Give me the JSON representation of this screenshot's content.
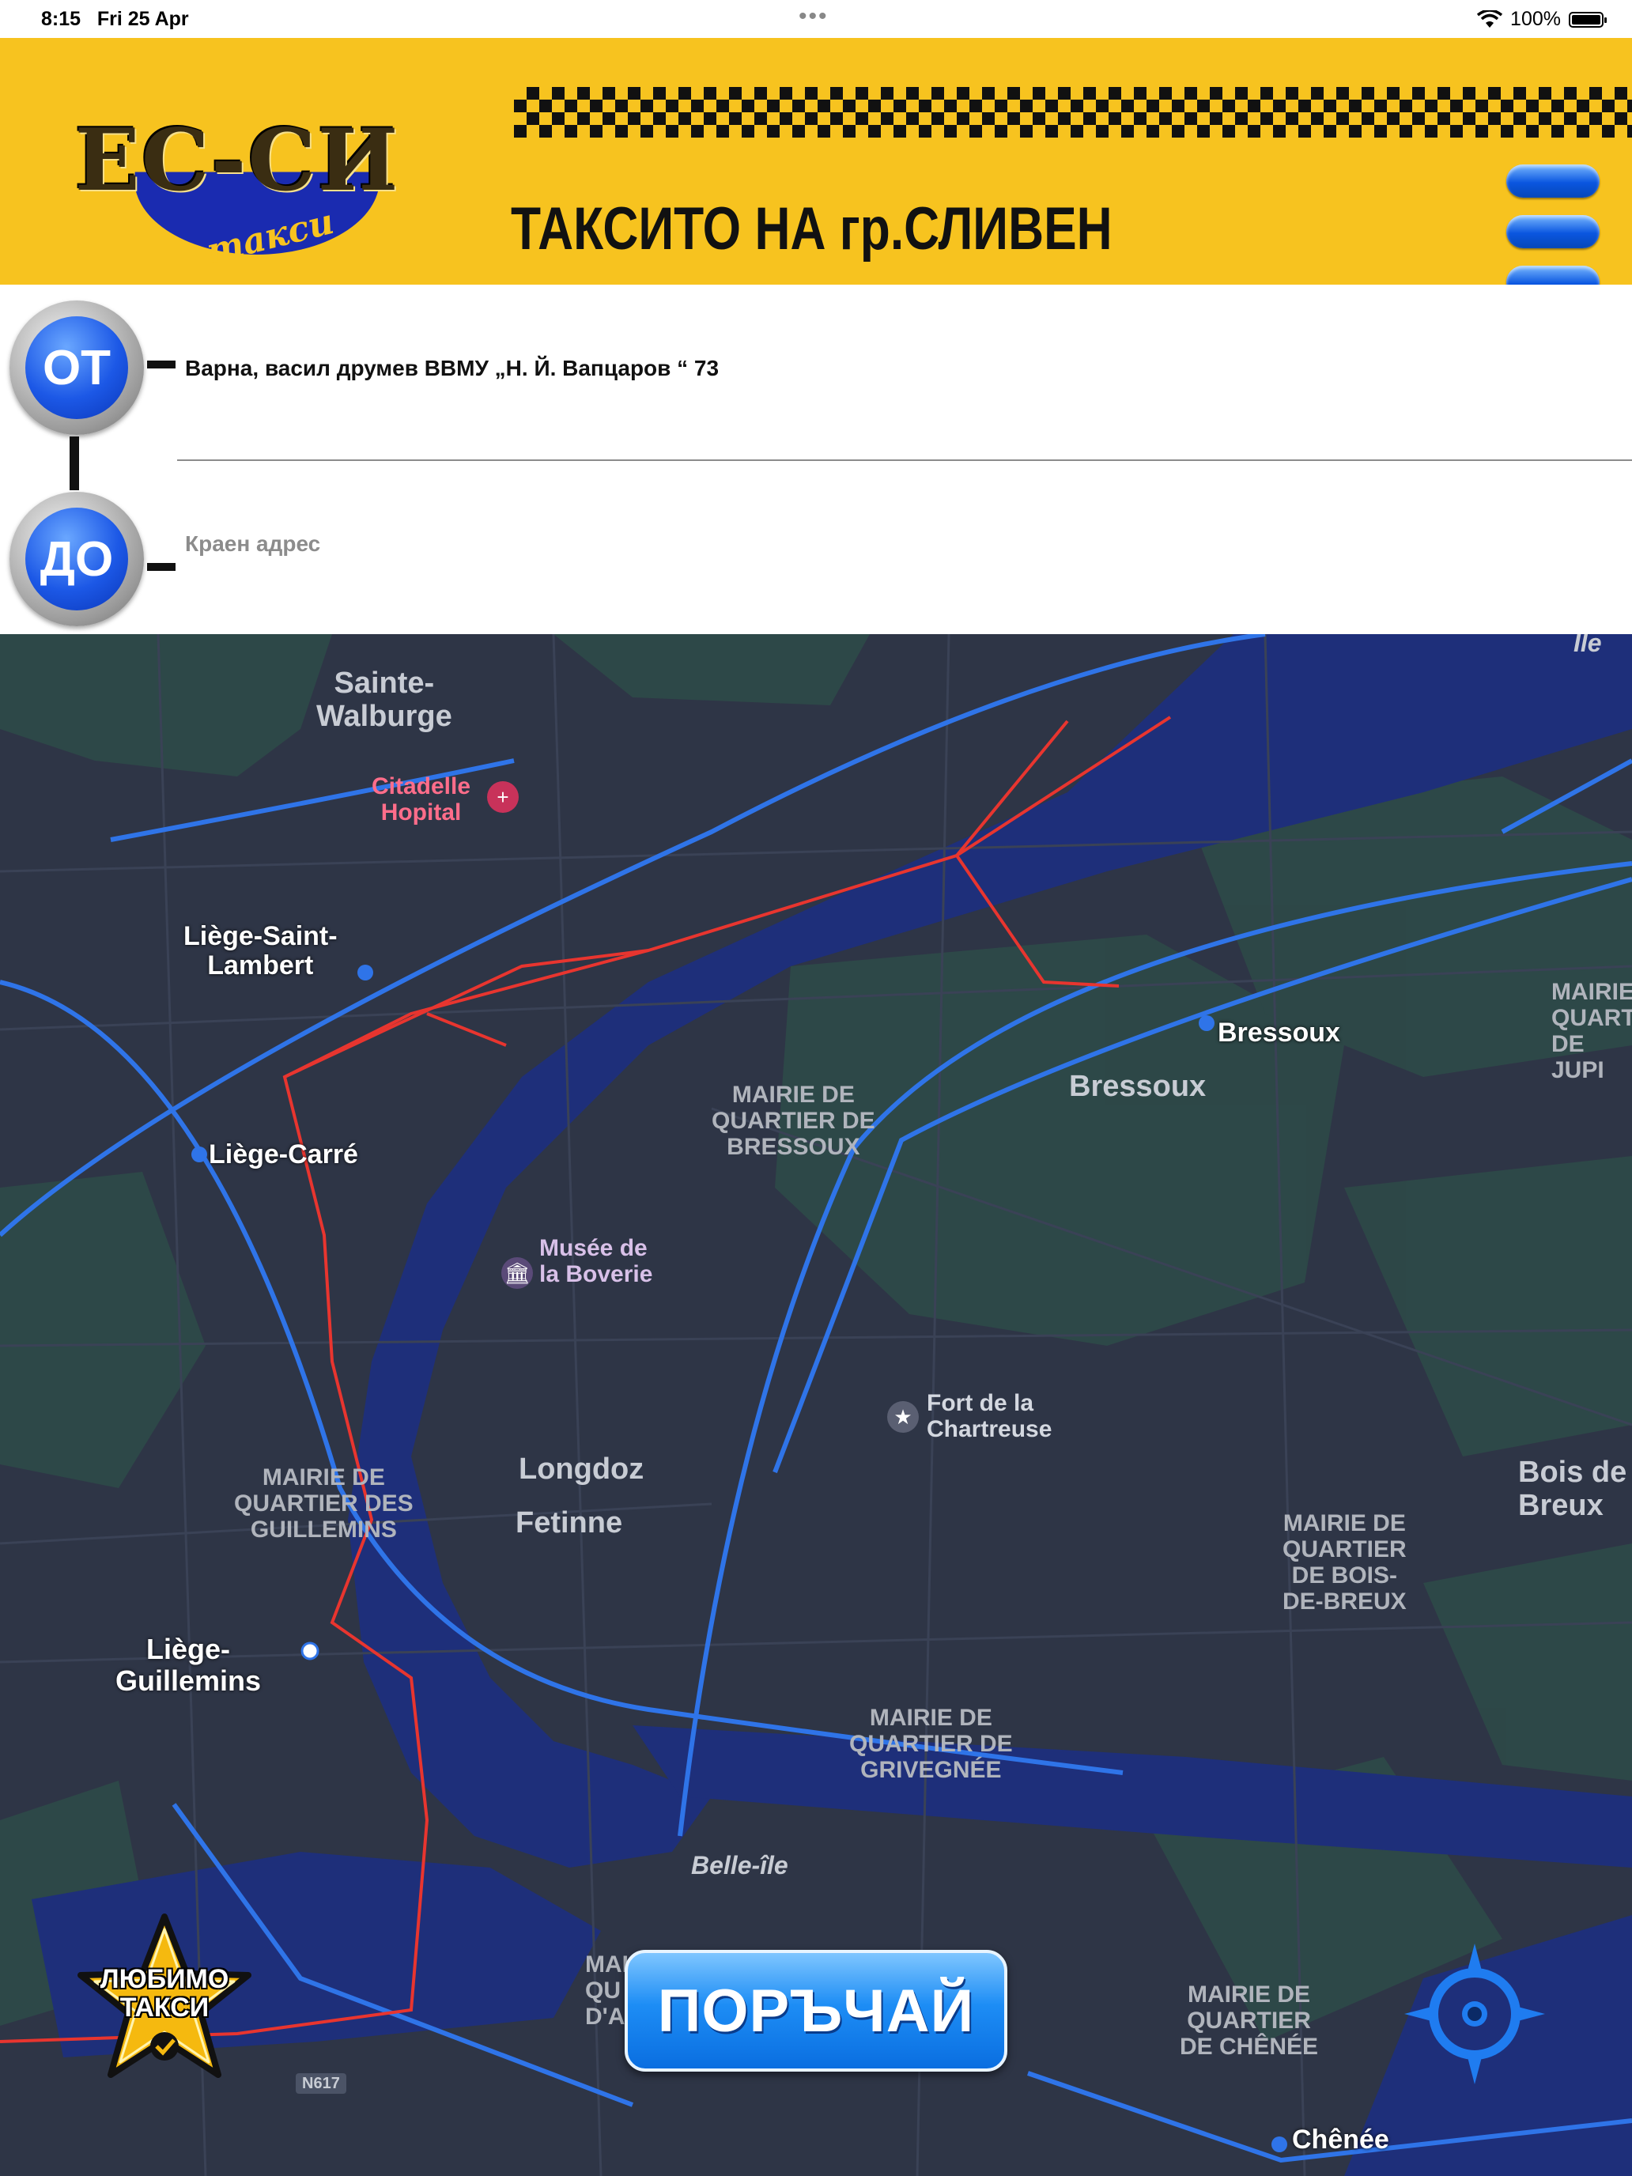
{
  "status_bar": {
    "time": "8:15",
    "date": "Fri 25 Apr",
    "more": "•••",
    "battery": "100%"
  },
  "header": {
    "logo_text": "ЕС-СИ",
    "logo_subtext": "такси",
    "tagline": "ТАКСИТО НА гр.СЛИВЕН",
    "menu_icon": "hamburger-menu-icon",
    "background_color": "#f7c31f"
  },
  "route": {
    "from_label": "ОТ",
    "to_label": "ДО",
    "from_value": "Варна, васил друмев ВВМУ „Н. Й. Вапцаров “ 73",
    "to_placeholder": "Краен адрес"
  },
  "map": {
    "labels": {
      "sainte_walburge": "Sainte-\nWalburge",
      "citadelle": "Citadelle\nHopital",
      "liege_saint_lambert": "Liège-Saint-\nLambert",
      "liege_carre": "Liège-Carré",
      "mairie_bressoux": "MAIRIE DE\nQUARTIER DE\nBRESSOUX",
      "bressoux_station": "Bressoux",
      "bressoux_area": "Bressoux",
      "mairie_jupille": "MAIRIE\nQUART\nDE JUPI",
      "musee": "Musée de\nla Boverie",
      "fort": "Fort de la\nChartreuse",
      "longdoz": "Longdoz",
      "fetinne": "Fetinne",
      "mairie_guillemins": "MAIRIE DE\nQUARTIER DES\nGUILLEMINS",
      "bois_breux": "Bois de\nBreux",
      "mairie_bois_breux": "MAIRIE DE\nQUARTIER\nDE BOIS-\nDE-BREUX",
      "liege_guillemins": "Liège-\nGuillemins",
      "mairie_grivegnee": "MAIRIE DE\nQUARTIER DE\nGRIVEGNÉE",
      "belle_ile": "Belle-île",
      "mairie_chenee": "MAIRIE DE\nQUARTIER\nDE CHÊNÉE",
      "chenee": "Chênée",
      "ile": "Île",
      "road_n617": "N617",
      "mairie_angleur": "MAI\nQU\nD'A"
    },
    "colors": {
      "background": "#2e3546",
      "water": "#1e2f7a",
      "rail": "#2f74e8",
      "route": "#e8352f"
    }
  },
  "favorite_button": {
    "label_line1": "ЛЮБИМО",
    "label_line2": "ТАКСИ",
    "icon": "star-badge-icon"
  },
  "order_button": {
    "label": "ПОРЪЧАЙ"
  },
  "locate_button": {
    "icon": "crosshair-locate-icon"
  }
}
